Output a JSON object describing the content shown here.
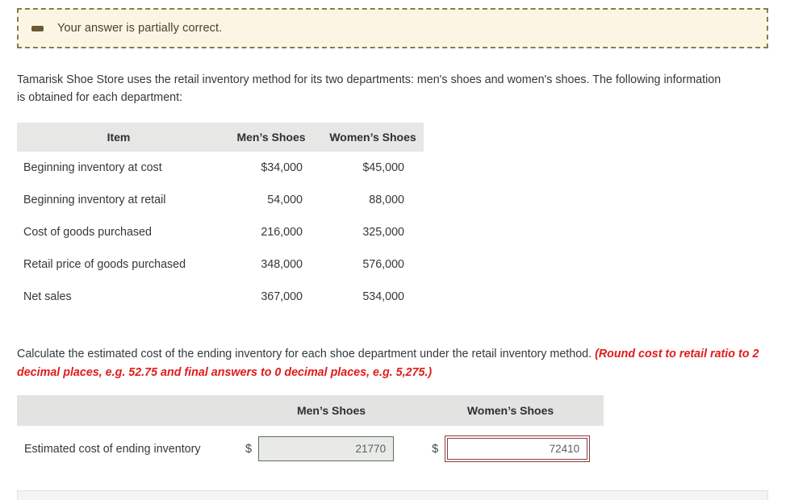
{
  "alert": {
    "icon": "minus-icon",
    "message": "Your answer is partially correct.",
    "background": "#fbf6e4",
    "border_color": "#8a7b4f"
  },
  "intro": {
    "paragraph": "Tamarisk Shoe Store uses the retail inventory method for its two departments: men's shoes and women's shoes. The following information is obtained for each department:"
  },
  "data_table": {
    "headers": [
      "Item",
      "Men’s Shoes",
      "Women’s Shoes"
    ],
    "rows": [
      {
        "label": "Beginning inventory at cost",
        "mens": "$34,000",
        "womens": "$45,000"
      },
      {
        "label": "Beginning inventory at retail",
        "mens": "54,000",
        "womens": "88,000"
      },
      {
        "label": "Cost of goods purchased",
        "mens": "216,000",
        "womens": "325,000"
      },
      {
        "label": "Retail price of goods purchased",
        "mens": "348,000",
        "womens": "576,000"
      },
      {
        "label": "Net sales",
        "mens": "367,000",
        "womens": "534,000"
      }
    ]
  },
  "prompt": {
    "main": "Calculate the estimated cost of the ending inventory for each shoe department under the retail inventory method. ",
    "hint": "(Round cost to retail ratio to 2 decimal places, e.g. 52.75 and final answers to 0 decimal places, e.g. 5,275.)",
    "hint_color": "#e01b1b"
  },
  "answer_table": {
    "headers": [
      "",
      "Men’s Shoes",
      "Women’s Shoes"
    ],
    "row_label": "Estimated cost of ending inventory",
    "currency_symbol": "$",
    "mens_answer": {
      "value": "21770",
      "placeholder": "",
      "state": "correct",
      "border_color": "#58705c",
      "background": "#e9eae7"
    },
    "womens_answer": {
      "value": "72410",
      "placeholder": "",
      "state": "incorrect",
      "border_color": "#8c3b3b",
      "background": "#ffffff"
    }
  }
}
